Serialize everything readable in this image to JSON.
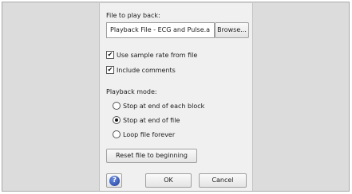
{
  "dialog": {
    "file_label": "File to play back:",
    "file_value": "Playback File - ECG and Pulse.a",
    "browse_label": "Browse...",
    "use_sample_rate_label": "Use sample rate from file",
    "use_sample_rate_checked": true,
    "include_comments_label": "Include comments",
    "include_comments_checked": true,
    "playback_mode_label": "Playback mode:",
    "modes": [
      {
        "label": "Stop at end of each block",
        "selected": false
      },
      {
        "label": "Stop at end of file",
        "selected": true
      },
      {
        "label": "Loop file forever",
        "selected": false
      }
    ],
    "reset_label": "Reset file to beginning",
    "help_glyph": "?",
    "help_icon": "help-icon",
    "ok_label": "OK",
    "cancel_label": "Cancel",
    "check_glyph": "✔"
  }
}
